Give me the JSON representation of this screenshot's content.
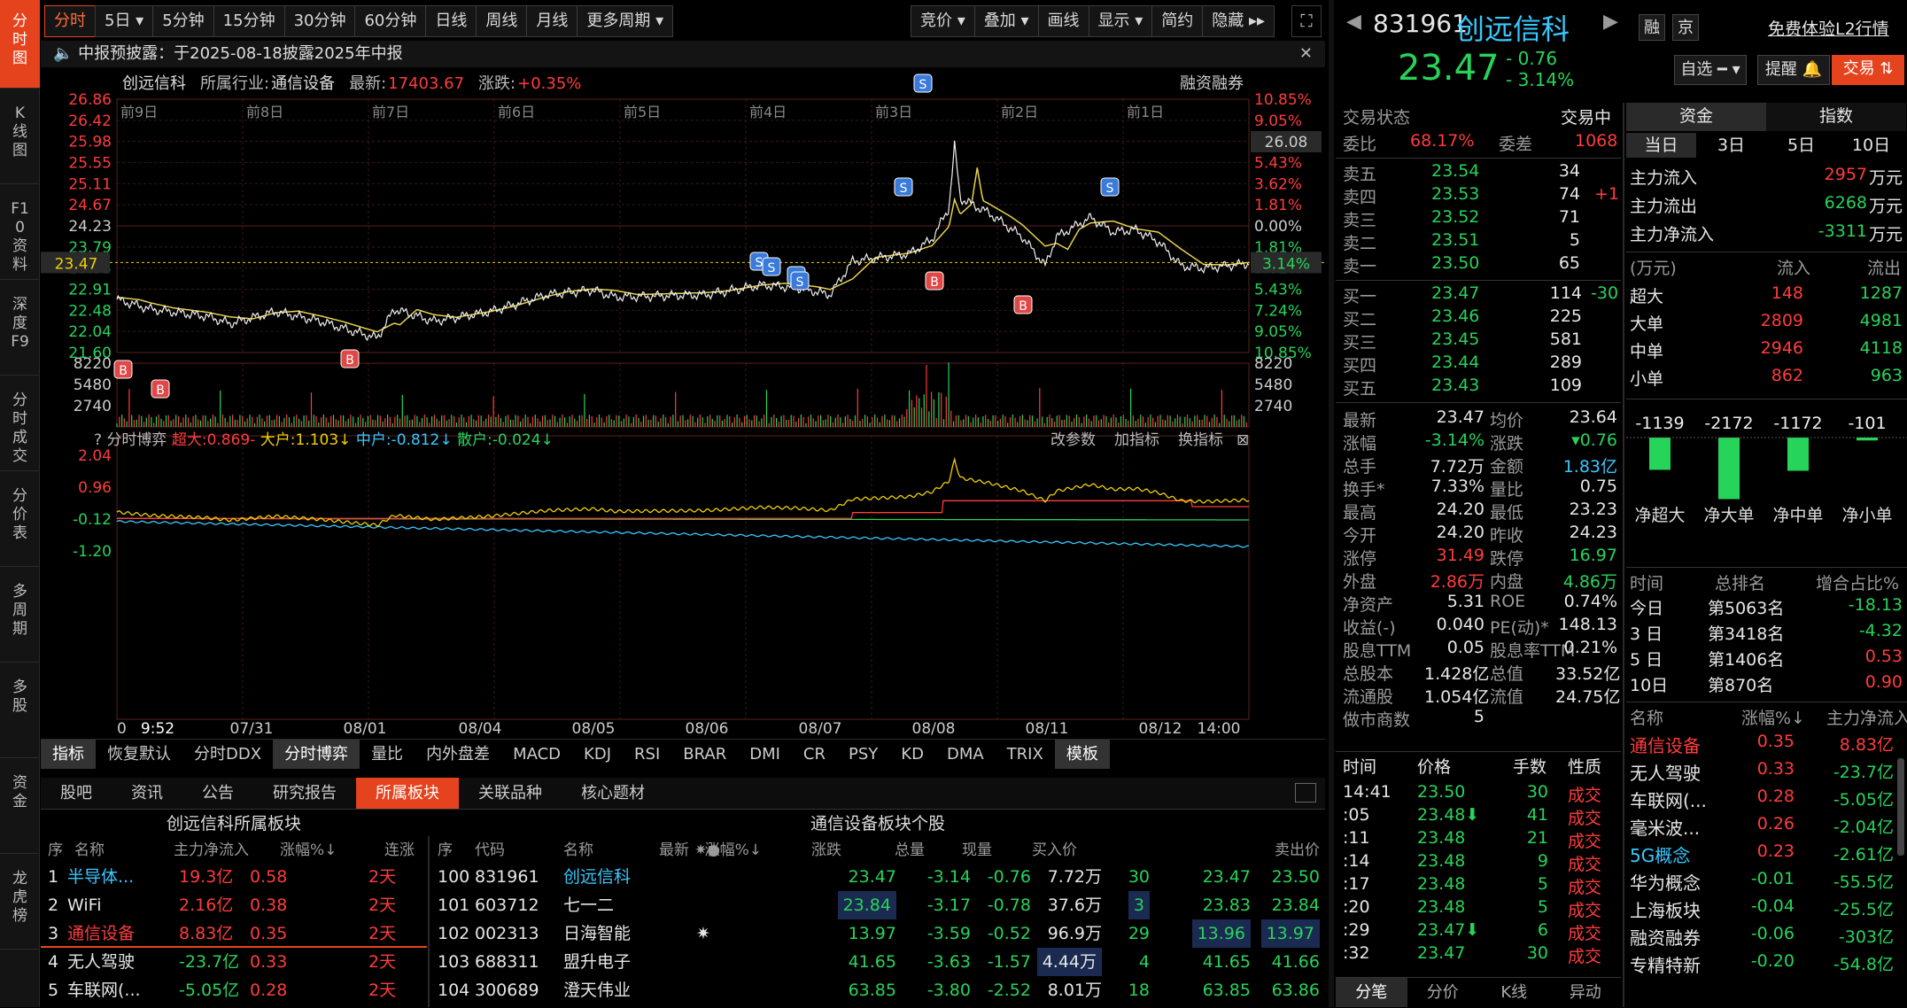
{
  "leftbar": [
    {
      "label": "分时图",
      "active": true
    },
    {
      "label": "K线图"
    },
    {
      "label": "F10资料"
    },
    {
      "label": "深度F9"
    },
    {
      "label": "分时成交"
    },
    {
      "label": "分价表"
    },
    {
      "label": "多周期"
    },
    {
      "label": "多股"
    },
    {
      "label": "资金"
    },
    {
      "label": "龙虎榜"
    }
  ],
  "toolbar": {
    "periods": [
      "分时",
      "5日 ▾",
      "5分钟",
      "15分钟",
      "30分钟",
      "60分钟",
      "日线",
      "周线",
      "月线",
      "更多周期 ▾"
    ],
    "right": [
      "竞价 ▾",
      "叠加 ▾",
      "画线",
      "显示 ▾",
      "简约",
      "隐藏 ▸▸"
    ]
  },
  "notice": {
    "label": "中报预披露：",
    "text": "于2025-08-18披露2025年中报"
  },
  "header": {
    "name": "创远信科",
    "industry_label": "所属行业:",
    "industry": "通信设备",
    "latest_label": "最新:",
    "latest": "17403.67",
    "change_label": "涨跌:",
    "change": "+0.35%",
    "margin": "融资融券"
  },
  "chart_data": {
    "type": "line",
    "price_ticks": [
      "26.86",
      "26.42",
      "25.98",
      "25.55",
      "25.11",
      "24.67",
      "24.23",
      "23.79",
      "23.35",
      "22.91",
      "22.48",
      "22.04",
      "21.60"
    ],
    "pct_ticks": [
      "10.85%",
      "9.05%",
      "7.24%",
      "5.43%",
      "3.62%",
      "1.81%",
      "0.00%",
      "1.81%",
      "3.62%",
      "5.43%",
      "7.24%",
      "9.05%",
      "10.85%"
    ],
    "day_labels": [
      "前9日",
      "前8日",
      "前7日",
      "前6日",
      "前5日",
      "前4日",
      "前3日",
      "前2日",
      "前1日"
    ],
    "current_price": "23.47",
    "current_pct": "3.14%",
    "high_marker": "26.08",
    "vol_ticks": [
      "8220",
      "5480",
      "2740"
    ],
    "ind_ticks": [
      "2.04",
      "0.96",
      "-0.12",
      "-1.20"
    ],
    "x_labels": [
      "0",
      "9:52",
      "07/31",
      "08/01",
      "08/04",
      "08/05",
      "08/06",
      "08/07",
      "08/08",
      "08/11",
      "08/12",
      "14:00"
    ]
  },
  "indicator": {
    "name": "分时博弈",
    "chaoda": "超大:0.869-",
    "dahu": "大户:1.103↓",
    "zhonghu": "中户:-0.812↓",
    "sanhu": "散户:-0.024↓",
    "actions": [
      "改参数",
      "加指标",
      "换指标"
    ]
  },
  "ind_tabs": [
    "指标",
    "恢复默认",
    "分时DDX",
    "分时博弈",
    "量比",
    "内外盘差",
    "MACD",
    "KDJ",
    "RSI",
    "BRAR",
    "DMI",
    "CR",
    "PSY",
    "KD",
    "DMA",
    "TRIX",
    "模板"
  ],
  "bottom_tabs": [
    "股吧",
    "资讯",
    "公告",
    "研究报告",
    "所属板块",
    "关联品种",
    "核心题材"
  ],
  "sector_table": {
    "title": "创远信科所属板块",
    "headers": [
      "序",
      "名称",
      "主力净流入",
      "涨幅%↓",
      "连涨"
    ],
    "rows": [
      [
        "1",
        "半导体...",
        "19.3亿",
        "0.58",
        "2天"
      ],
      [
        "2",
        "WiFi",
        "2.16亿",
        "0.38",
        "2天"
      ],
      [
        "3",
        "通信设备",
        "8.83亿",
        "0.35",
        "2天"
      ],
      [
        "4",
        "无人驾驶",
        "-23.7亿",
        "0.33",
        "2天"
      ],
      [
        "5",
        "车联网(...",
        "-5.05亿",
        "0.28",
        "2天"
      ]
    ]
  },
  "stock_table": {
    "title": "通信设备板块个股",
    "headers": [
      "序",
      "代码",
      "名称",
      "✷●",
      "最新",
      "涨幅%↓",
      "涨跌",
      "总量",
      "现量",
      "买入价",
      "卖出价"
    ],
    "rows": [
      [
        "100",
        "831961",
        "创远信科",
        "",
        "23.47",
        "-3.14",
        "-0.76",
        "7.72万",
        "30",
        "23.47",
        "23.50"
      ],
      [
        "101",
        "603712",
        "七一二",
        "",
        "23.84",
        "-3.17",
        "-0.78",
        "37.6万",
        "3",
        "23.83",
        "23.84"
      ],
      [
        "102",
        "002313",
        "日海智能",
        "✷",
        "13.97",
        "-3.59",
        "-0.52",
        "96.9万",
        "29",
        "13.96",
        "13.97"
      ],
      [
        "103",
        "688311",
        "盟升电子",
        "",
        "41.65",
        "-3.63",
        "-1.57",
        "4.44万",
        "4",
        "41.65",
        "41.66"
      ],
      [
        "104",
        "300689",
        "澄天伟业",
        "",
        "63.85",
        "-3.80",
        "-2.52",
        "8.01万",
        "18",
        "63.85",
        "63.86"
      ]
    ]
  },
  "quote": {
    "code": "831961",
    "name": "创远信科",
    "price": "23.47",
    "change": "- 0.76",
    "pct": "- 3.14%",
    "btns": [
      "融",
      "京"
    ],
    "l2": "免费体验L2行情",
    "zixuan": "自选 ━ ▾",
    "tixing": "提醒 🔔",
    "jiaoyi": "交易 ⇅"
  },
  "trade_status": {
    "label": "交易状态",
    "value": "交易中",
    "weibi_label": "委比",
    "weibi": "68.17%",
    "weicha_label": "委差",
    "weicha": "1068"
  },
  "asks": [
    [
      "卖五",
      "23.54",
      "34",
      ""
    ],
    [
      "卖四",
      "23.53",
      "74",
      "+1"
    ],
    [
      "卖三",
      "23.52",
      "71",
      ""
    ],
    [
      "卖二",
      "23.51",
      "5",
      ""
    ],
    [
      "卖一",
      "23.50",
      "65",
      ""
    ]
  ],
  "bids": [
    [
      "买一",
      "23.47",
      "114",
      "-30"
    ],
    [
      "买二",
      "23.46",
      "225",
      ""
    ],
    [
      "买三",
      "23.45",
      "581",
      ""
    ],
    [
      "买四",
      "23.44",
      "289",
      ""
    ],
    [
      "买五",
      "23.43",
      "109",
      ""
    ]
  ],
  "stats": [
    [
      "最新",
      "23.47",
      "均价",
      "23.64"
    ],
    [
      "涨幅",
      "-3.14%",
      "涨跌",
      "▾0.76"
    ],
    [
      "总手",
      "7.72万",
      "金额",
      "1.83亿"
    ],
    [
      "换手*",
      "7.33%",
      "量比",
      "0.75"
    ],
    [
      "最高",
      "24.20",
      "最低",
      "23.23"
    ],
    [
      "今开",
      "24.20",
      "昨收",
      "24.23"
    ],
    [
      "涨停",
      "31.49",
      "跌停",
      "16.97"
    ],
    [
      "外盘",
      "2.86万",
      "内盘",
      "4.86万"
    ],
    [
      "净资产",
      "5.31",
      "ROE",
      "0.74%"
    ],
    [
      "收益(-)",
      "0.040",
      "PE(动)*",
      "148.13"
    ],
    [
      "股息TTM",
      "0.05",
      "股息率TTM",
      "0.21%"
    ],
    [
      "总股本",
      "1.428亿",
      "总值",
      "33.52亿"
    ],
    [
      "流通股",
      "1.054亿",
      "流值",
      "24.75亿"
    ],
    [
      "做市商数",
      "5",
      "",
      ""
    ]
  ],
  "ticks_header": [
    "时间",
    "价格",
    "手数",
    "性质"
  ],
  "ticks": [
    [
      "14:41",
      "23.50",
      "30",
      "成交"
    ],
    [
      ":05",
      "23.48⬇",
      "41",
      "成交"
    ],
    [
      ":11",
      "23.48",
      "21",
      "成交"
    ],
    [
      ":14",
      "23.48",
      "9",
      "成交"
    ],
    [
      ":17",
      "23.48",
      "5",
      "成交"
    ],
    [
      ":20",
      "23.48",
      "5",
      "成交"
    ],
    [
      ":29",
      "23.47⬇",
      "6",
      "成交"
    ],
    [
      ":32",
      "23.47",
      "30",
      "成交"
    ]
  ],
  "tick_tabs": [
    "分笔",
    "分价",
    "K线",
    "异动"
  ],
  "fund": {
    "tabs": [
      "资金",
      "指数"
    ],
    "periods": [
      "当日",
      "3日",
      "5日",
      "10日"
    ],
    "flows": [
      [
        "主力流入",
        "2957",
        "万元"
      ],
      [
        "主力流出",
        "6268",
        "万元"
      ],
      [
        "主力净流入",
        "-3311",
        "万元"
      ]
    ],
    "unit_hdr": [
      "(万元)",
      "流入",
      "流出"
    ],
    "sizes": [
      [
        "超大",
        "148",
        "1287"
      ],
      [
        "大单",
        "2809",
        "4981"
      ],
      [
        "中单",
        "2946",
        "4118"
      ],
      [
        "小单",
        "862",
        "963"
      ]
    ],
    "bars": [
      {
        "label": "净超大",
        "value": -1139
      },
      {
        "label": "净大单",
        "value": -2172
      },
      {
        "label": "净中单",
        "value": -1172
      },
      {
        "label": "净小单",
        "value": -101
      }
    ],
    "rank_hdr": [
      "时间",
      "总排名",
      "增合占比%"
    ],
    "ranks": [
      [
        "今日",
        "第5063名",
        "-18.13"
      ],
      [
        "3 日",
        "第3418名",
        "-4.32"
      ],
      [
        "5 日",
        "第1406名",
        "0.53"
      ],
      [
        "10日",
        "第870名",
        "0.90"
      ]
    ]
  },
  "sectors": {
    "headers": [
      "名称",
      "涨幅%↓",
      "主力净流入"
    ],
    "rows": [
      [
        "通信设备",
        "0.35",
        "8.83亿"
      ],
      [
        "无人驾驶",
        "0.33",
        "-23.7亿"
      ],
      [
        "车联网(...",
        "0.28",
        "-5.05亿"
      ],
      [
        "毫米波...",
        "0.26",
        "-2.04亿"
      ],
      [
        "5G概念",
        "0.23",
        "-2.61亿"
      ],
      [
        "华为概念",
        "-0.01",
        "-55.5亿"
      ],
      [
        "上海板块",
        "-0.04",
        "-25.5亿"
      ],
      [
        "融资融券",
        "-0.06",
        "-303亿"
      ],
      [
        "专精特新",
        "-0.20",
        "-54.8亿"
      ]
    ]
  }
}
